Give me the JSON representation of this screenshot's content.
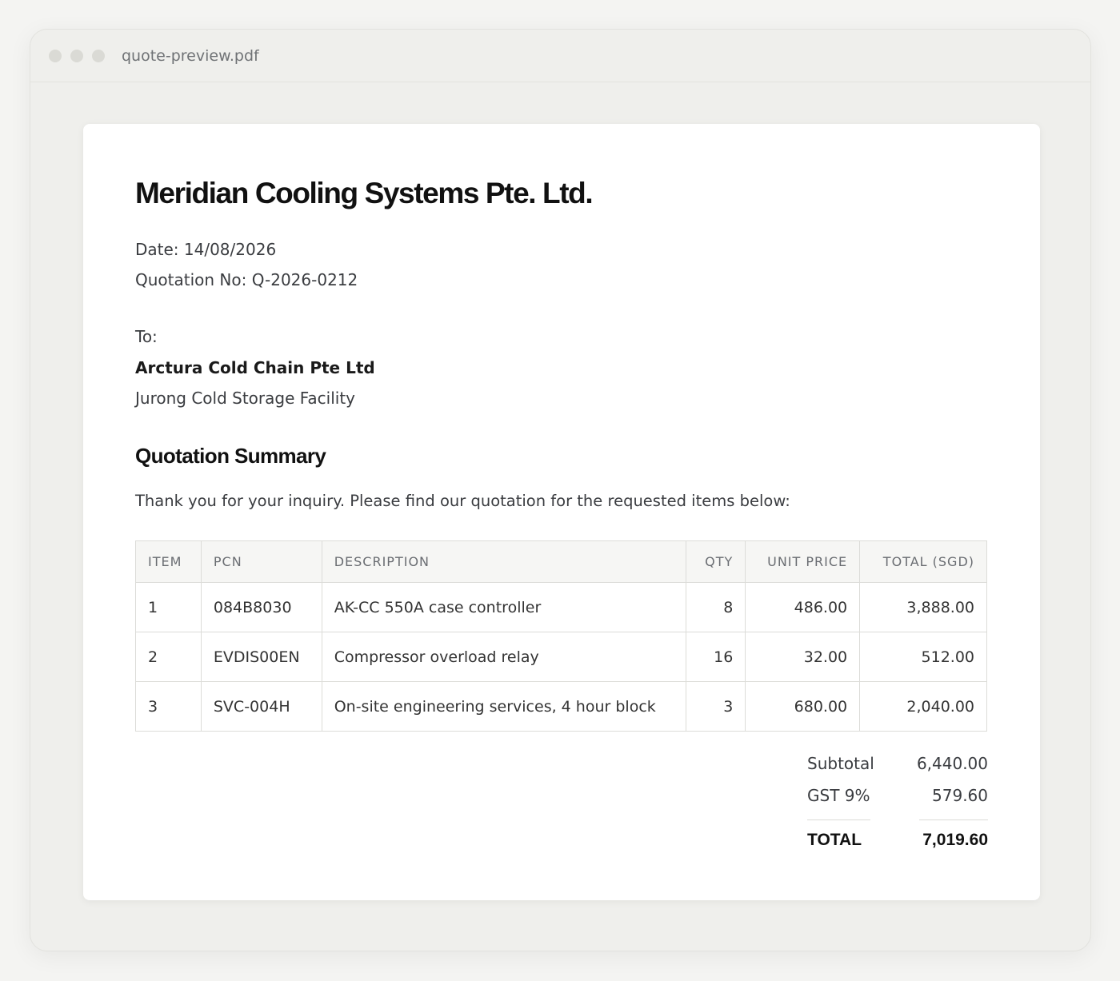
{
  "window": {
    "filename": "quote-preview.pdf"
  },
  "document": {
    "company": "Meridian Cooling Systems Pte. Ltd.",
    "date": "Date: 14/08/2026",
    "quotation_no": "Quotation No: Q-2026-0212",
    "to_label": "To:",
    "recipient_name": "Arctura Cold Chain Pte Ltd",
    "recipient_site": "Jurong Cold Storage Facility",
    "section_title": "Quotation Summary",
    "intro": "Thank you for your inquiry. Please find our quotation for the requested items below:"
  },
  "table": {
    "headers": [
      "ITEM",
      "PCN",
      "DESCRIPTION",
      "QTY",
      "UNIT PRICE",
      "TOTAL (SGD)"
    ],
    "rows": [
      [
        "1",
        "084B8030",
        "AK-CC 550A case controller",
        "8",
        "486.00",
        "3,888.00"
      ],
      [
        "2",
        "EVDIS00EN",
        "Compressor overload relay",
        "16",
        "32.00",
        "512.00"
      ],
      [
        "3",
        "SVC-004H",
        "On-site engineering services, 4 hour block",
        "3",
        "680.00",
        "2,040.00"
      ]
    ]
  },
  "totals": {
    "subtotal_label": "Subtotal",
    "subtotal_value": "6,440.00",
    "gst_label": "GST 9%",
    "gst_value": "579.60",
    "total_label": "TOTAL",
    "total_value": "7,019.60"
  }
}
